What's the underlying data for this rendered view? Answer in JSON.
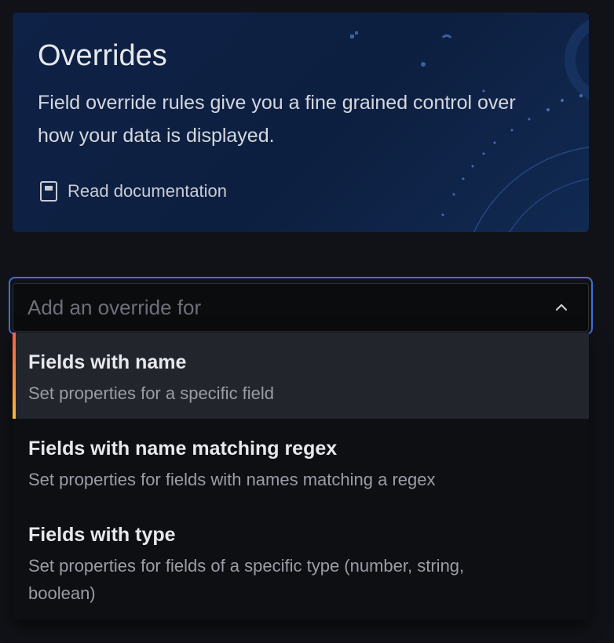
{
  "banner": {
    "title": "Overrides",
    "description": "Field override rules give you a fine grained control over how your data is displayed.",
    "doc_link_label": "Read documentation",
    "doc_icon": "book-icon"
  },
  "select": {
    "placeholder": "Add an override for",
    "value": "",
    "toggle_icon": "chevron-up-icon",
    "focus_color": "#3d71d9"
  },
  "menu": {
    "items": [
      {
        "title": "Fields with name",
        "description": "Set properties for a specific field",
        "active": true
      },
      {
        "title": "Fields with name matching regex",
        "description": "Set properties for fields with names matching a regex",
        "active": false
      },
      {
        "title": "Fields with type",
        "description": "Set properties for fields of a specific type (number, string, boolean)",
        "active": false
      }
    ]
  },
  "colors": {
    "background": "#111217",
    "banner_background": "#0e2146",
    "active_item_background": "#22252b",
    "active_accent_start": "#f0604a",
    "active_accent_end": "#f5b73b"
  }
}
